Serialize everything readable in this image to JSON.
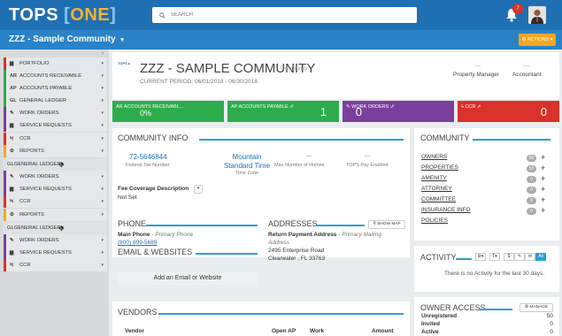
{
  "app": {
    "logo_main": "TOPS",
    "logo_bracket_open": "[",
    "logo_one": "ONE",
    "logo_bracket_close": "]",
    "search_placeholder": "SEARCH",
    "notification_count": "7"
  },
  "subbar": {
    "community_name": "ZZZ - Sample Community",
    "dropdown_caret": "▾",
    "actions_label": "⚙ ACTIONS ▾"
  },
  "sidebar": {
    "items": [
      {
        "icon": "▆",
        "label": "PORTFOLIO",
        "color": "#d9322b"
      },
      {
        "icon": "AR",
        "label": "ACCOUNTS RECEIVABLE",
        "color": "#2eac4d"
      },
      {
        "icon": "AP",
        "label": "ACCOUNTS PAYABLE",
        "color": "#2eac4d"
      },
      {
        "icon": "GL",
        "label": "GENERAL LEDGER",
        "color": "#2eac4d"
      },
      {
        "icon": "✎",
        "label": "WORK ORDERS",
        "color": "#7b3f9e"
      },
      {
        "icon": "▆",
        "label": "SERVICE REQUESTS",
        "color": "#7b3f9e"
      },
      {
        "icon": "ϟ",
        "label": "CCR",
        "color": "#d9322b"
      },
      {
        "icon": "⚙",
        "label": "REPORTS",
        "color": "#f5a623"
      },
      {
        "icon": "GL",
        "label": "GENERAL LEDGER",
        "color": "#999"
      },
      {
        "icon": "✎",
        "label": "WORK ORDERS",
        "color": "#7b3f9e"
      },
      {
        "icon": "▆",
        "label": "SERVICE REQUESTS",
        "color": "#7b3f9e"
      },
      {
        "icon": "ϟ",
        "label": "CCR",
        "color": "#d9322b"
      },
      {
        "icon": "⚙",
        "label": "REPORTS",
        "color": "#f5a623"
      },
      {
        "icon": "GL",
        "label": "GENERAL LEDGER",
        "color": "#999"
      },
      {
        "icon": "✎",
        "label": "WORK ORDERS",
        "color": "#7b3f9e"
      },
      {
        "icon": "▆",
        "label": "SERVICE REQUESTS",
        "color": "#7b3f9e"
      },
      {
        "icon": "ϟ",
        "label": "CCR",
        "color": "#d9322b"
      }
    ]
  },
  "header": {
    "title": "ZZZ - SAMPLE COMMUNITY",
    "subtitle": "Community",
    "period": "CURRENT PERIOD: 06/01/2018 - 06/30/2018",
    "manager_value": "—",
    "manager_label": "Property Manager",
    "accountant_value": "—",
    "accountant_label": "Accountant"
  },
  "kpis": [
    {
      "label": "AR ACCOUNTS RECEIVABL...",
      "value": "0%",
      "color": "#2eac4d"
    },
    {
      "label": "AP ACCOUNTS PAYABLE ⇗",
      "value": "1",
      "color": "#2eac4d"
    },
    {
      "label": "✎ WORK ORDERS ⇗",
      "value": "0",
      "color": "#7b3f9e"
    },
    {
      "label": "ϟ CCR ⇗",
      "value": "0",
      "color": "#d9322b"
    }
  ],
  "community_info": {
    "title": "COMMUNITY INFO",
    "tax_number": "72-5646844",
    "tax_label": "Federal Tax Number",
    "tz_line1": "Mountain",
    "tz_line2": "Standard Time",
    "tz_label": "Time Zone",
    "max_homes_value": "—",
    "max_homes_label": "Max Number of Homes",
    "tops_pay_value": "—",
    "tops_pay_label": "TOPS Pay Enabled",
    "fee_label": "Fee Coverage Description",
    "fee_value": "Not Set"
  },
  "phone": {
    "title": "PHONE",
    "main_label": "Main Phone",
    "main_type": " - Primary Phone",
    "number": "(800) 899-5689"
  },
  "email": {
    "title": "EMAIL & WEBSITES",
    "add_label": "Add an Email or Website"
  },
  "addresses": {
    "title": "ADDRESSES",
    "show_map": "⚲ SHOW MAP",
    "type_label": "Return Payment Address",
    "type_desc": " - Primary Mailing",
    "type_desc2": "Address",
    "line1": "2495 Enterprise Road",
    "line2": "Clearwater , FL 33763"
  },
  "vendors": {
    "title": "VENDORS",
    "columns": [
      "Vendor",
      "Open AP",
      "Work",
      "Amount"
    ]
  },
  "community": {
    "title": "COMMUNITY",
    "rows": [
      {
        "label": "OWNERS",
        "count": "50"
      },
      {
        "label": "PROPERTIES",
        "count": "50"
      },
      {
        "label": "AMENITY",
        "count": "0"
      },
      {
        "label": "ATTORNEY",
        "count": "0"
      },
      {
        "label": "COMMITTEE",
        "count": "0"
      },
      {
        "label": "INSURANCE INFO",
        "count": "0"
      },
      {
        "label": "POLICIES",
        "count": ""
      }
    ]
  },
  "activity": {
    "title": "ACTIVITY",
    "empty_text": "There is no Activity for the last 30 days.",
    "filters": [
      "⚙▾",
      "T▾",
      "$",
      "✎",
      "✉",
      "All"
    ]
  },
  "owner_access": {
    "title": "OWNER ACCESS",
    "manage_label": "⚙ MANAGE",
    "rows": [
      {
        "label": "Unregistered",
        "value": "50"
      },
      {
        "label": "Invited",
        "value": "0"
      },
      {
        "label": "Active",
        "value": "0"
      }
    ]
  }
}
